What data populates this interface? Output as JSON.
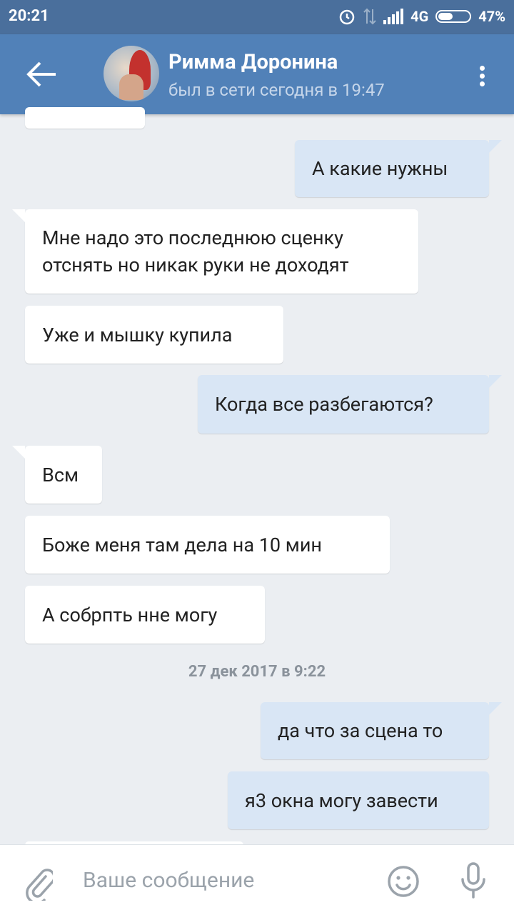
{
  "statusbar": {
    "time": "20:21",
    "network": "4G",
    "battery": "47%",
    "battery_level": 0.47
  },
  "header": {
    "name": "Римма Доронина",
    "status": "был в сети сегодня в 19:47"
  },
  "messages": [
    {
      "dir": "out",
      "text": "А какие нужны"
    },
    {
      "dir": "in",
      "text": "Мне надо это последнюю сценку отснять но никак руки не доходят"
    },
    {
      "dir": "in",
      "text": "Уже и мышку купила"
    },
    {
      "dir": "out",
      "text": "Когда все разбегаются?"
    },
    {
      "dir": "in",
      "text": "Всм"
    },
    {
      "dir": "in",
      "text": "Боже меня там дела на 10 мин"
    },
    {
      "dir": "in",
      "text": "А собрпть нне могу"
    },
    {
      "dir": "out",
      "text": "да что за сцена то"
    },
    {
      "dir": "out",
      "text": "я3 окна могу завести"
    }
  ],
  "date_separator": "27 дек 2017 в 9:22",
  "input": {
    "placeholder": "Ваше сообщение"
  },
  "icons": [
    "back-arrow-icon",
    "more-vert-icon",
    "attach-icon",
    "emoji-icon",
    "mic-icon"
  ]
}
